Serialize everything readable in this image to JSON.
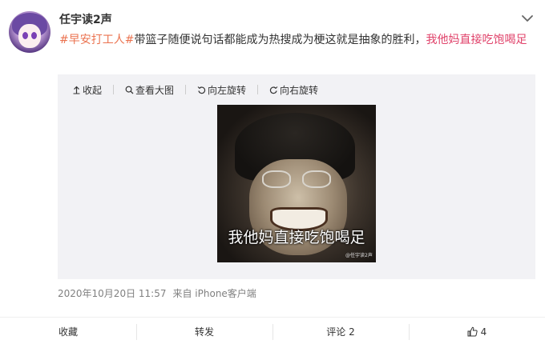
{
  "post": {
    "username": "任宇读2声",
    "topic": "#早安打工人#",
    "text": "带篮子随便说句话都能成为热搜成为梗这就是抽象的胜利",
    "comma": "，",
    "highlight": "我他妈直接吃饱喝足",
    "timestamp": "2020年10月20日 11:57",
    "source": "来自 iPhone客户端"
  },
  "media": {
    "toolbar": {
      "collapse": "收起",
      "view_large": "查看大图",
      "rotate_left": "向左旋转",
      "rotate_right": "向右旋转"
    },
    "photo": {
      "caption": "我他妈直接吃饱喝足",
      "watermark": "@任宇读2声"
    }
  },
  "actions": {
    "favorite": "收藏",
    "repost": "转发",
    "comment": "评论 2",
    "like_count": "4"
  },
  "icons": {
    "menu": "chevron-down-icon",
    "collapse": "arrow-up-icon",
    "view_large": "search-icon",
    "rotate_left": "rotate-left-icon",
    "rotate_right": "rotate-right-icon",
    "like": "thumbs-up-icon"
  },
  "colors": {
    "topic": "#eb7350",
    "highlight": "#e0426a",
    "meta": "#808080"
  }
}
